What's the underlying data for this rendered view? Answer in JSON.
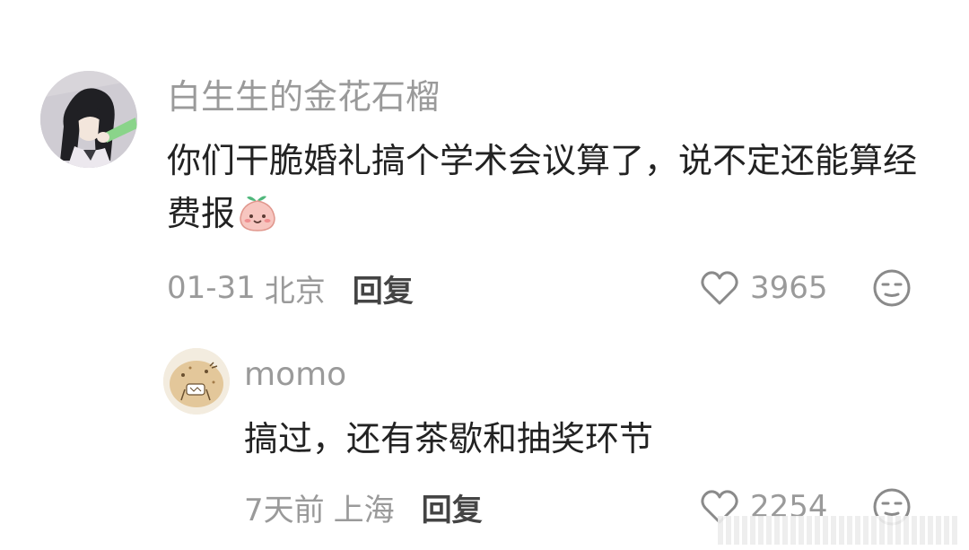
{
  "comment": {
    "username": "白生生的金花石榴",
    "text": "你们干脆婚礼搞个学术会议算了，说不定还能算经费报",
    "emoji": "peach-face-emoji",
    "date": "01-31",
    "location": "北京",
    "reply_label": "回复",
    "like_count": "3965",
    "like_icon": "heart-outline-icon",
    "react_icon": "meh-face-icon"
  },
  "reply": {
    "username": "momo",
    "text": "搞过，还有茶歇和抽奖环节",
    "date": "7天前",
    "location": "上海",
    "reply_label": "回复",
    "like_count": "2254",
    "like_icon": "heart-outline-icon",
    "react_icon": "meh-face-icon"
  },
  "colors": {
    "username": "#9a9a9a",
    "body_text": "#222222",
    "meta_text": "#9a9a9a",
    "reply_button": "#444444"
  }
}
